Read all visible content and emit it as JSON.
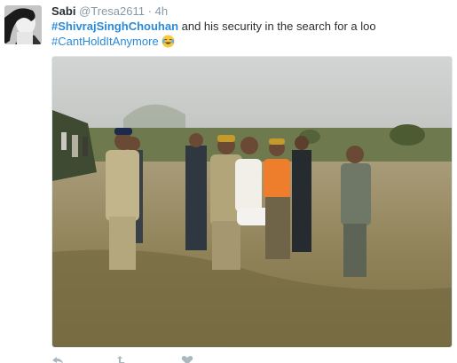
{
  "tweet": {
    "author_name": "Sabi",
    "handle": "@Tresa2611",
    "separator": "·",
    "time": "4h",
    "hashtag_main": "#ShivrajSinghChouhan",
    "text_middle": " and his security in the search for a loo",
    "hashtag_second": "#CantHoldItAnymore",
    "emoji": "tears-of-joy-emoji"
  },
  "actions": [
    "reply-icon",
    "retweet-icon",
    "like-icon"
  ],
  "colors": {
    "hashtag": "#2a8ad8",
    "muted": "#8899a6",
    "text": "#292f33"
  }
}
